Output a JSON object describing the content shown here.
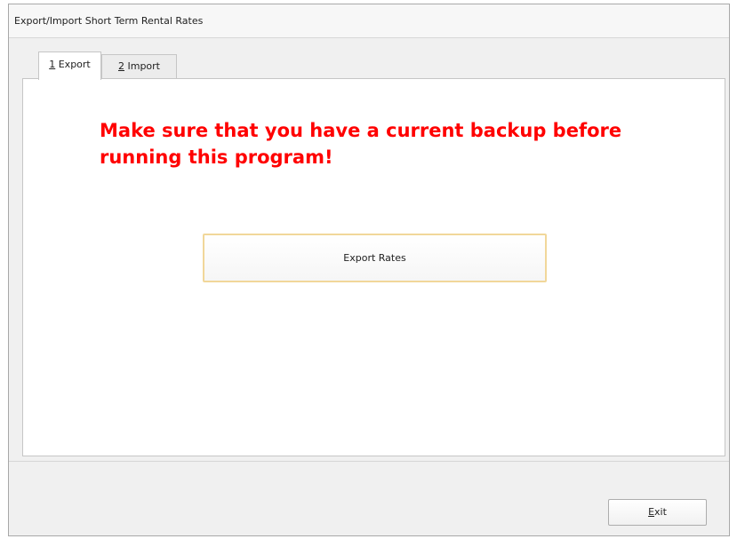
{
  "window": {
    "title": "Export/Import Short Term Rental Rates"
  },
  "tabs": [
    {
      "mnemonic": "1",
      "label": " Export",
      "selected": true
    },
    {
      "mnemonic": "2",
      "label": " Import",
      "selected": false
    }
  ],
  "export_panel": {
    "warning": "Make sure that you have a current backup before running this program!",
    "export_button_label": "Export Rates"
  },
  "footer": {
    "exit_mnemonic": "E",
    "exit_rest": "xit"
  },
  "colors": {
    "warning_text": "#ff0000",
    "button_focus_border": "#f1d79a",
    "window_background": "#f0f0f0"
  }
}
